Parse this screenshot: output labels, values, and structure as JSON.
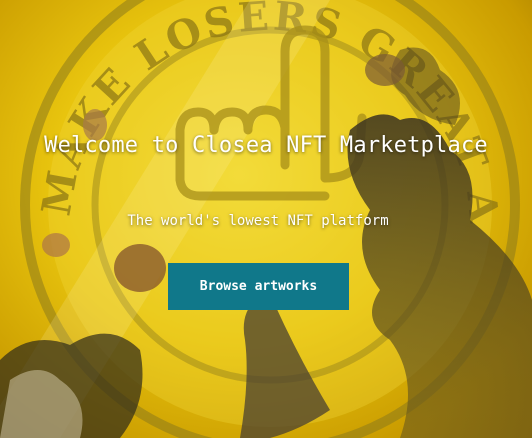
{
  "hero": {
    "title": "Welcome to Closea NFT Marketplace",
    "subtitle": "The world's lowest NFT platform",
    "cta_label": "Browse artworks",
    "background_art": "make-losers-great-again-hand-emblem-artwork"
  },
  "colors": {
    "button_bg": "#10788a",
    "text": "#ffffff",
    "background_yellow": "#e8c40e"
  }
}
